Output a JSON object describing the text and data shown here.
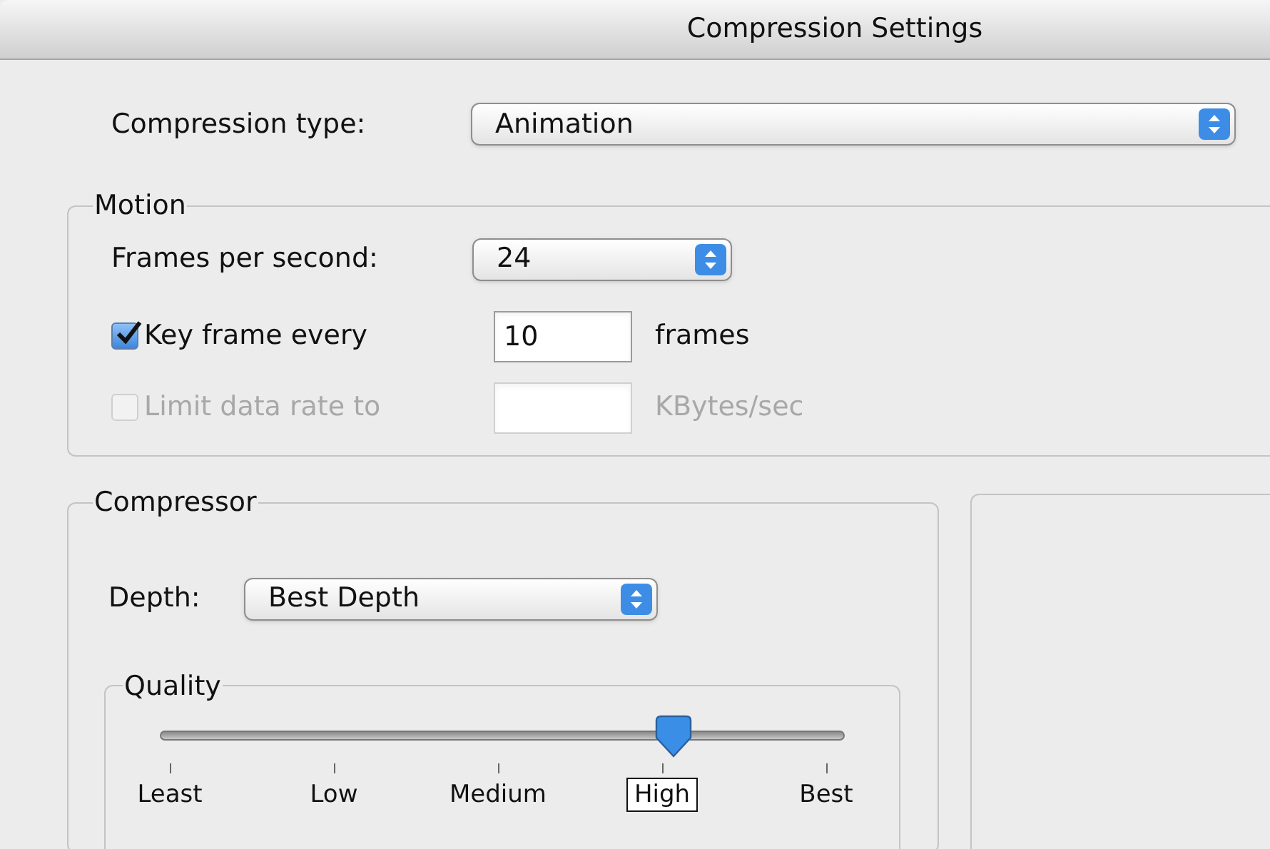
{
  "window": {
    "title": "Compression Settings"
  },
  "compression_type": {
    "label": "Compression type:",
    "value": "Animation"
  },
  "motion": {
    "title": "Motion",
    "frames_per_second": {
      "label": "Frames per second:",
      "value": "24"
    },
    "options": [
      {
        "label": "Key frame every",
        "checked": true,
        "disabled": false,
        "value": "10",
        "unit": "frames"
      },
      {
        "label": "Limit data rate to",
        "checked": false,
        "disabled": true,
        "unit": "KBytes/sec"
      }
    ]
  },
  "compressor": {
    "title": "Compressor",
    "depth": {
      "label": "Depth:",
      "value": "Best Depth"
    },
    "quality": {
      "title": "Quality",
      "level": 0.75,
      "ticks": [
        {
          "label": "Least",
          "selected": false
        },
        {
          "label": "Low",
          "selected": false
        },
        {
          "label": "Medium",
          "selected": false
        },
        {
          "label": "High",
          "selected": true
        },
        {
          "label": "Best",
          "selected": false
        }
      ]
    }
  }
}
